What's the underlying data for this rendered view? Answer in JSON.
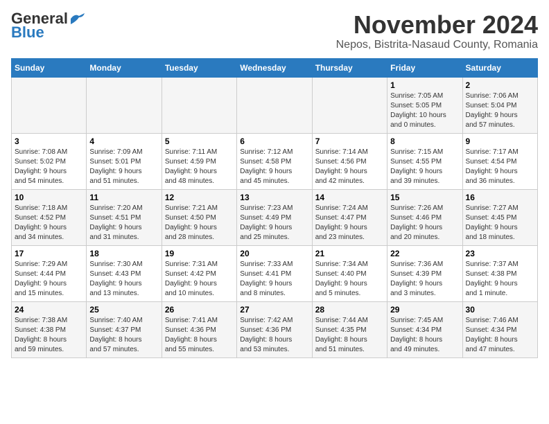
{
  "logo": {
    "general": "General",
    "blue": "Blue"
  },
  "title": "November 2024",
  "location": "Nepos, Bistrita-Nasaud County, Romania",
  "days_of_week": [
    "Sunday",
    "Monday",
    "Tuesday",
    "Wednesday",
    "Thursday",
    "Friday",
    "Saturday"
  ],
  "weeks": [
    [
      {
        "day": "",
        "info": ""
      },
      {
        "day": "",
        "info": ""
      },
      {
        "day": "",
        "info": ""
      },
      {
        "day": "",
        "info": ""
      },
      {
        "day": "",
        "info": ""
      },
      {
        "day": "1",
        "info": "Sunrise: 7:05 AM\nSunset: 5:05 PM\nDaylight: 10 hours\nand 0 minutes."
      },
      {
        "day": "2",
        "info": "Sunrise: 7:06 AM\nSunset: 5:04 PM\nDaylight: 9 hours\nand 57 minutes."
      }
    ],
    [
      {
        "day": "3",
        "info": "Sunrise: 7:08 AM\nSunset: 5:02 PM\nDaylight: 9 hours\nand 54 minutes."
      },
      {
        "day": "4",
        "info": "Sunrise: 7:09 AM\nSunset: 5:01 PM\nDaylight: 9 hours\nand 51 minutes."
      },
      {
        "day": "5",
        "info": "Sunrise: 7:11 AM\nSunset: 4:59 PM\nDaylight: 9 hours\nand 48 minutes."
      },
      {
        "day": "6",
        "info": "Sunrise: 7:12 AM\nSunset: 4:58 PM\nDaylight: 9 hours\nand 45 minutes."
      },
      {
        "day": "7",
        "info": "Sunrise: 7:14 AM\nSunset: 4:56 PM\nDaylight: 9 hours\nand 42 minutes."
      },
      {
        "day": "8",
        "info": "Sunrise: 7:15 AM\nSunset: 4:55 PM\nDaylight: 9 hours\nand 39 minutes."
      },
      {
        "day": "9",
        "info": "Sunrise: 7:17 AM\nSunset: 4:54 PM\nDaylight: 9 hours\nand 36 minutes."
      }
    ],
    [
      {
        "day": "10",
        "info": "Sunrise: 7:18 AM\nSunset: 4:52 PM\nDaylight: 9 hours\nand 34 minutes."
      },
      {
        "day": "11",
        "info": "Sunrise: 7:20 AM\nSunset: 4:51 PM\nDaylight: 9 hours\nand 31 minutes."
      },
      {
        "day": "12",
        "info": "Sunrise: 7:21 AM\nSunset: 4:50 PM\nDaylight: 9 hours\nand 28 minutes."
      },
      {
        "day": "13",
        "info": "Sunrise: 7:23 AM\nSunset: 4:49 PM\nDaylight: 9 hours\nand 25 minutes."
      },
      {
        "day": "14",
        "info": "Sunrise: 7:24 AM\nSunset: 4:47 PM\nDaylight: 9 hours\nand 23 minutes."
      },
      {
        "day": "15",
        "info": "Sunrise: 7:26 AM\nSunset: 4:46 PM\nDaylight: 9 hours\nand 20 minutes."
      },
      {
        "day": "16",
        "info": "Sunrise: 7:27 AM\nSunset: 4:45 PM\nDaylight: 9 hours\nand 18 minutes."
      }
    ],
    [
      {
        "day": "17",
        "info": "Sunrise: 7:29 AM\nSunset: 4:44 PM\nDaylight: 9 hours\nand 15 minutes."
      },
      {
        "day": "18",
        "info": "Sunrise: 7:30 AM\nSunset: 4:43 PM\nDaylight: 9 hours\nand 13 minutes."
      },
      {
        "day": "19",
        "info": "Sunrise: 7:31 AM\nSunset: 4:42 PM\nDaylight: 9 hours\nand 10 minutes."
      },
      {
        "day": "20",
        "info": "Sunrise: 7:33 AM\nSunset: 4:41 PM\nDaylight: 9 hours\nand 8 minutes."
      },
      {
        "day": "21",
        "info": "Sunrise: 7:34 AM\nSunset: 4:40 PM\nDaylight: 9 hours\nand 5 minutes."
      },
      {
        "day": "22",
        "info": "Sunrise: 7:36 AM\nSunset: 4:39 PM\nDaylight: 9 hours\nand 3 minutes."
      },
      {
        "day": "23",
        "info": "Sunrise: 7:37 AM\nSunset: 4:38 PM\nDaylight: 9 hours\nand 1 minute."
      }
    ],
    [
      {
        "day": "24",
        "info": "Sunrise: 7:38 AM\nSunset: 4:38 PM\nDaylight: 8 hours\nand 59 minutes."
      },
      {
        "day": "25",
        "info": "Sunrise: 7:40 AM\nSunset: 4:37 PM\nDaylight: 8 hours\nand 57 minutes."
      },
      {
        "day": "26",
        "info": "Sunrise: 7:41 AM\nSunset: 4:36 PM\nDaylight: 8 hours\nand 55 minutes."
      },
      {
        "day": "27",
        "info": "Sunrise: 7:42 AM\nSunset: 4:36 PM\nDaylight: 8 hours\nand 53 minutes."
      },
      {
        "day": "28",
        "info": "Sunrise: 7:44 AM\nSunset: 4:35 PM\nDaylight: 8 hours\nand 51 minutes."
      },
      {
        "day": "29",
        "info": "Sunrise: 7:45 AM\nSunset: 4:34 PM\nDaylight: 8 hours\nand 49 minutes."
      },
      {
        "day": "30",
        "info": "Sunrise: 7:46 AM\nSunset: 4:34 PM\nDaylight: 8 hours\nand 47 minutes."
      }
    ]
  ]
}
